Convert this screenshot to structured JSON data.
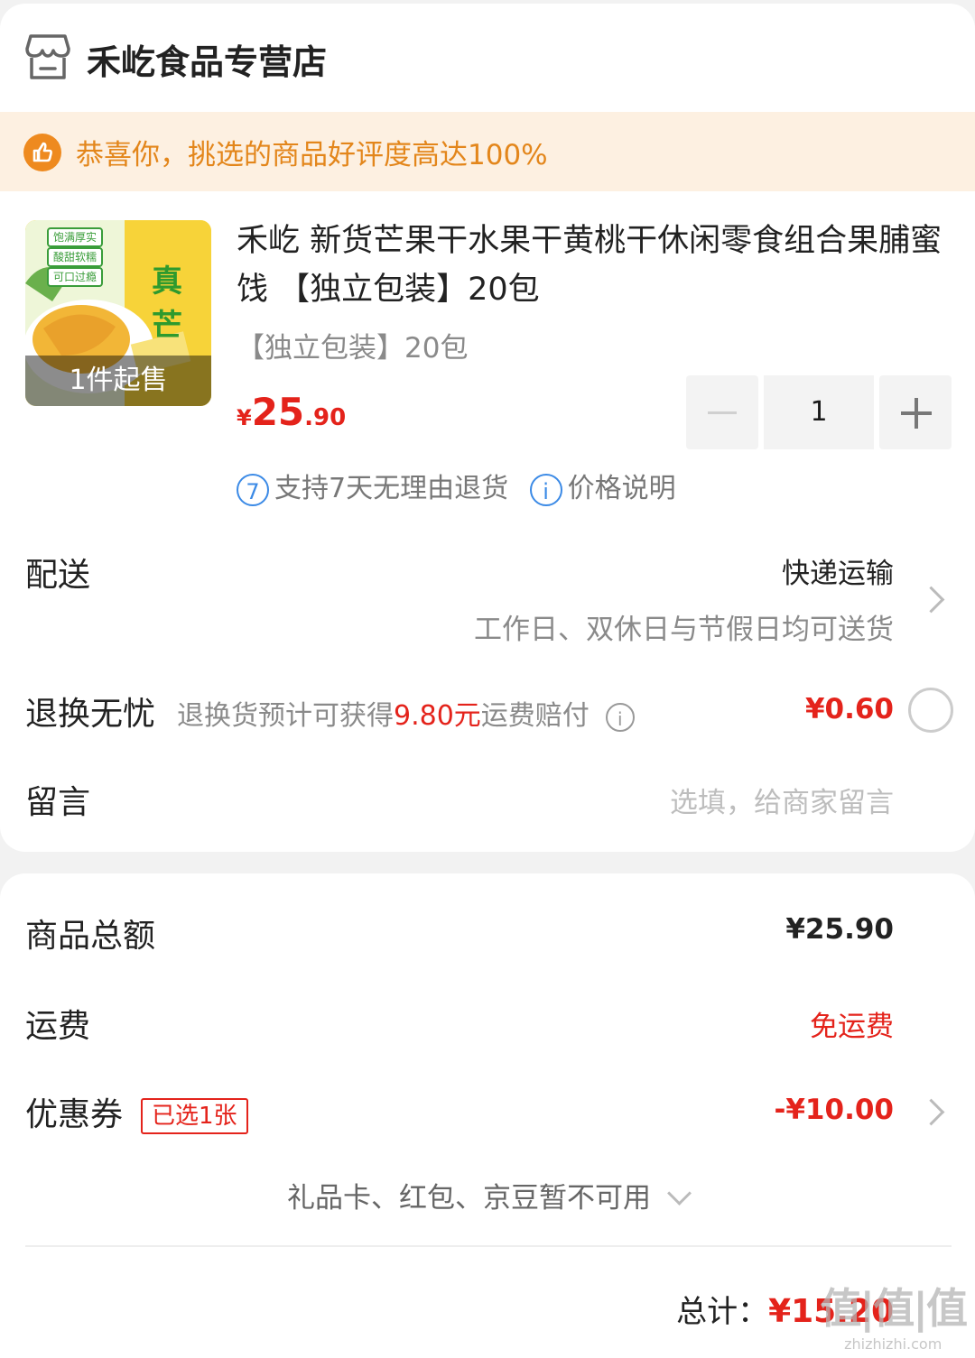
{
  "store": {
    "name": "禾屹食品专营店",
    "icon": "store-icon"
  },
  "banner": {
    "text": "恭喜你，挑选的商品好评度高达100%",
    "icon": "thumbs-up-icon"
  },
  "product": {
    "image_tag": "1件起售",
    "image_chips": [
      "饱满厚实",
      "酸甜软糯",
      "可口过瘾"
    ],
    "image_brand": "真芒",
    "title": "禾屹 新货芒果干水果干黄桃干休闲零食组合果脯蜜饯 【独立包装】20包",
    "spec": "【独立包装】20包",
    "price_symbol": "¥",
    "price_int": "25",
    "price_dec": ".90",
    "quantity": "1",
    "services": [
      {
        "badge": "7",
        "text": "支持7天无理由退货"
      },
      {
        "badge": "i",
        "text": "价格说明"
      }
    ]
  },
  "delivery": {
    "label": "配送",
    "method": "快递运输",
    "note": "工作日、双休日与节假日均可送货"
  },
  "return_worry": {
    "label": "退换无忧",
    "note_prefix": "退换货预计可获得",
    "note_amount": "9.80元",
    "note_suffix": "运费赔付",
    "price": "¥0.60",
    "selected": false
  },
  "message": {
    "label": "留言",
    "placeholder": "选填，给商家留言"
  },
  "summary": {
    "goods_total_label": "商品总额",
    "goods_total_value": "¥25.90",
    "shipping_label": "运费",
    "shipping_value": "免运费",
    "coupon_label": "优惠券",
    "coupon_chip": "已选1张",
    "coupon_value": "-¥10.00",
    "unavailable_text": "礼品卡、红包、京豆暂不可用",
    "total_label": "总计：",
    "total_value": "¥15.20"
  },
  "watermark": {
    "big": "值|值|值",
    "small": "zhizhizhi.com"
  },
  "colors": {
    "accent_red": "#e4231b",
    "banner_bg": "#fdf0e1",
    "banner_text": "#e3861b",
    "service_blue": "#3b8ae6"
  }
}
